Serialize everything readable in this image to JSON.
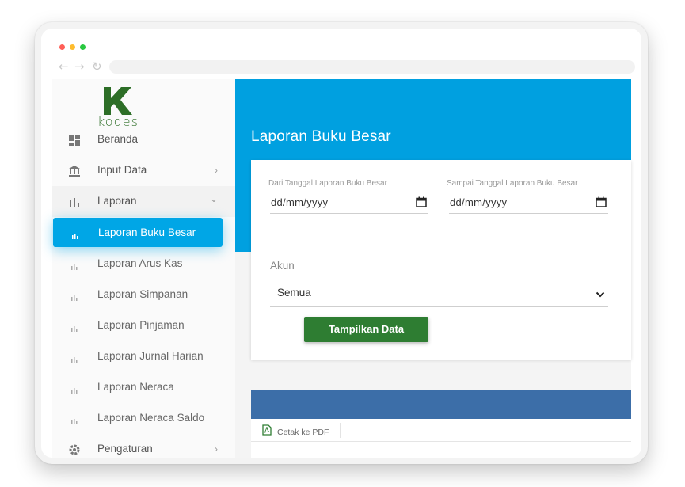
{
  "app": {
    "logo_text": "kodes",
    "brand_color": "#2d6e27",
    "accent_color": "#00a0e0",
    "button_color": "#2e7d32"
  },
  "window": {
    "controls": [
      "close",
      "minimize",
      "maximize"
    ],
    "control_colors": [
      "#ff5f57",
      "#febc2e",
      "#28c840"
    ],
    "nav_icons": [
      "back-arrow-icon",
      "forward-arrow-icon",
      "reload-icon"
    ]
  },
  "sidebar": {
    "items": [
      {
        "label": "Beranda",
        "icon": "dashboard-icon"
      },
      {
        "label": "Input Data",
        "icon": "bank-icon",
        "chevron": "›"
      },
      {
        "label": "Laporan",
        "icon": "bar-chart-icon",
        "chevron": "⌄"
      },
      {
        "label": "Laporan Buku Besar",
        "icon": "bar-chart-small-icon",
        "active": true
      },
      {
        "label": "Laporan Arus Kas",
        "icon": "bar-chart-small-icon"
      },
      {
        "label": "Laporan Simpanan",
        "icon": "bar-chart-small-icon"
      },
      {
        "label": "Laporan Pinjaman",
        "icon": "bar-chart-small-icon"
      },
      {
        "label": "Laporan Jurnal Harian",
        "icon": "bar-chart-small-icon"
      },
      {
        "label": "Laporan Neraca",
        "icon": "bar-chart-small-icon"
      },
      {
        "label": "Laporan Neraca Saldo",
        "icon": "bar-chart-small-icon"
      },
      {
        "label": "Pengaturan",
        "icon": "gear-icon",
        "chevron": "›"
      }
    ]
  },
  "main": {
    "page_title": "Laporan Buku Besar",
    "form": {
      "from_label": "Dari Tanggal Laporan Buku Besar",
      "from_value": "dd/mm/yyyy",
      "to_label": "Sampai Tanggal Laporan Buku Besar",
      "to_value": "dd/mm/yyyy",
      "akun_label": "Akun",
      "akun_value": "Semua",
      "submit_label": "Tampilkan Data"
    },
    "table": {
      "header_color": "#3c6ea8",
      "export_pdf_label": "Cetak ke PDF"
    }
  }
}
